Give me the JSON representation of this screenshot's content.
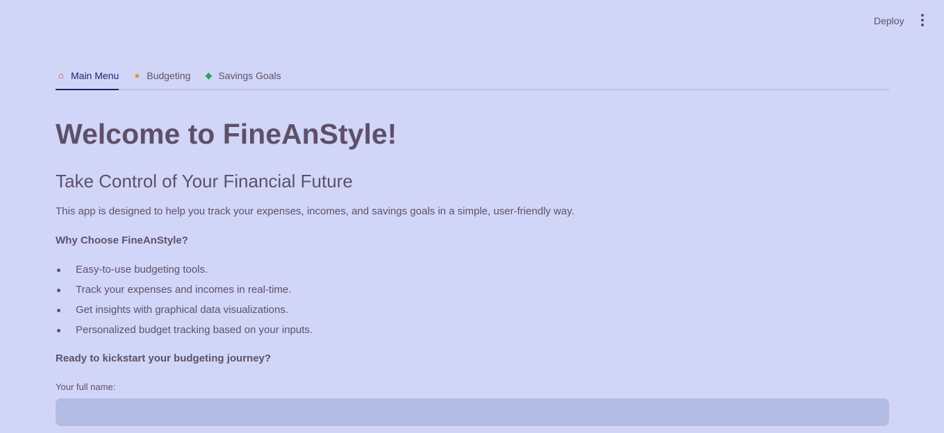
{
  "header": {
    "deploy_label": "Deploy",
    "menu_icon": "vertical-dots-icon"
  },
  "tabs": [
    {
      "label": "Main Menu",
      "icon": "house-icon",
      "active": true
    },
    {
      "label": "Budgeting",
      "icon": "money-bag-icon",
      "active": false
    },
    {
      "label": "Savings Goals",
      "icon": "money-with-wings-icon",
      "active": false
    }
  ],
  "main": {
    "title": "Welcome to FineAnStyle!",
    "subtitle": "Take Control of Your Financial Future",
    "intro": "This app is designed to help you track your expenses, incomes, and savings goals in a simple, user-friendly way.",
    "why_heading": "Why Choose FineAnStyle?",
    "features": [
      "Easy-to-use budgeting tools.",
      "Track your expenses and incomes in real-time.",
      "Get insights with graphical data visualizations.",
      "Personalized budget tracking based on your inputs."
    ],
    "cta": "Ready to kickstart your budgeting journey?",
    "name_field": {
      "label": "Your full name:",
      "value": "",
      "placeholder": ""
    }
  },
  "colors": {
    "background": "#d1d6f8",
    "text": "#5e5068",
    "active_tab": "#1f1f6e",
    "input_bg": "#b3bce3"
  }
}
